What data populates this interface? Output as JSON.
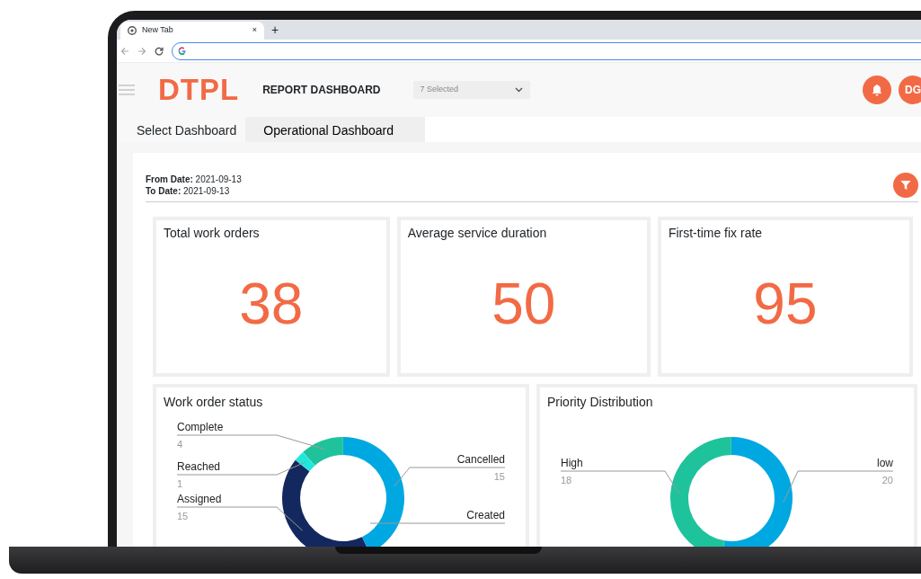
{
  "browser": {
    "tab_title": "New Tab",
    "close": "×",
    "new_tab": "+"
  },
  "header": {
    "logo": "DTPL",
    "title": "REPORT DASHBOARD",
    "dropdown": {
      "value": "7 Selected"
    },
    "avatar": "DG"
  },
  "dashboard_select": {
    "label": "Select Dashboard",
    "tabs": [
      {
        "label": "Operational Dashboard",
        "selected": true
      }
    ]
  },
  "dates": [
    {
      "label": "From Date:",
      "value": "2021-09-13"
    },
    {
      "label": "To Date:",
      "value": "2021-09-13"
    }
  ],
  "kpis": [
    {
      "title": "Total work orders",
      "value": "38"
    },
    {
      "title": "Average service duration",
      "value": "50"
    },
    {
      "title": "First-time fix rate",
      "value": "95"
    }
  ],
  "charts": [
    {
      "title": "Work order status",
      "chart_data": {
        "type": "donut",
        "categories": [
          "Cancelled",
          "Created",
          "Assigned",
          "Reached",
          "Complete"
        ],
        "series": [
          {
            "colors": [
              "#00a8e1",
              null,
              "#13285e",
              "#1ee8dc",
              "#1fc39b"
            ],
            "values": [
              15,
              null,
              15,
              1,
              4
            ]
          }
        ],
        "data_labels": true
      }
    },
    {
      "title": "Priority Distribution",
      "chart_data": {
        "type": "donut",
        "categories": [
          "low",
          "High"
        ],
        "series": [
          {
            "colors": [
              "#00a8e1",
              "#1fc39b"
            ],
            "values": [
              20,
              18
            ]
          }
        ],
        "data_labels": true
      }
    }
  ]
}
